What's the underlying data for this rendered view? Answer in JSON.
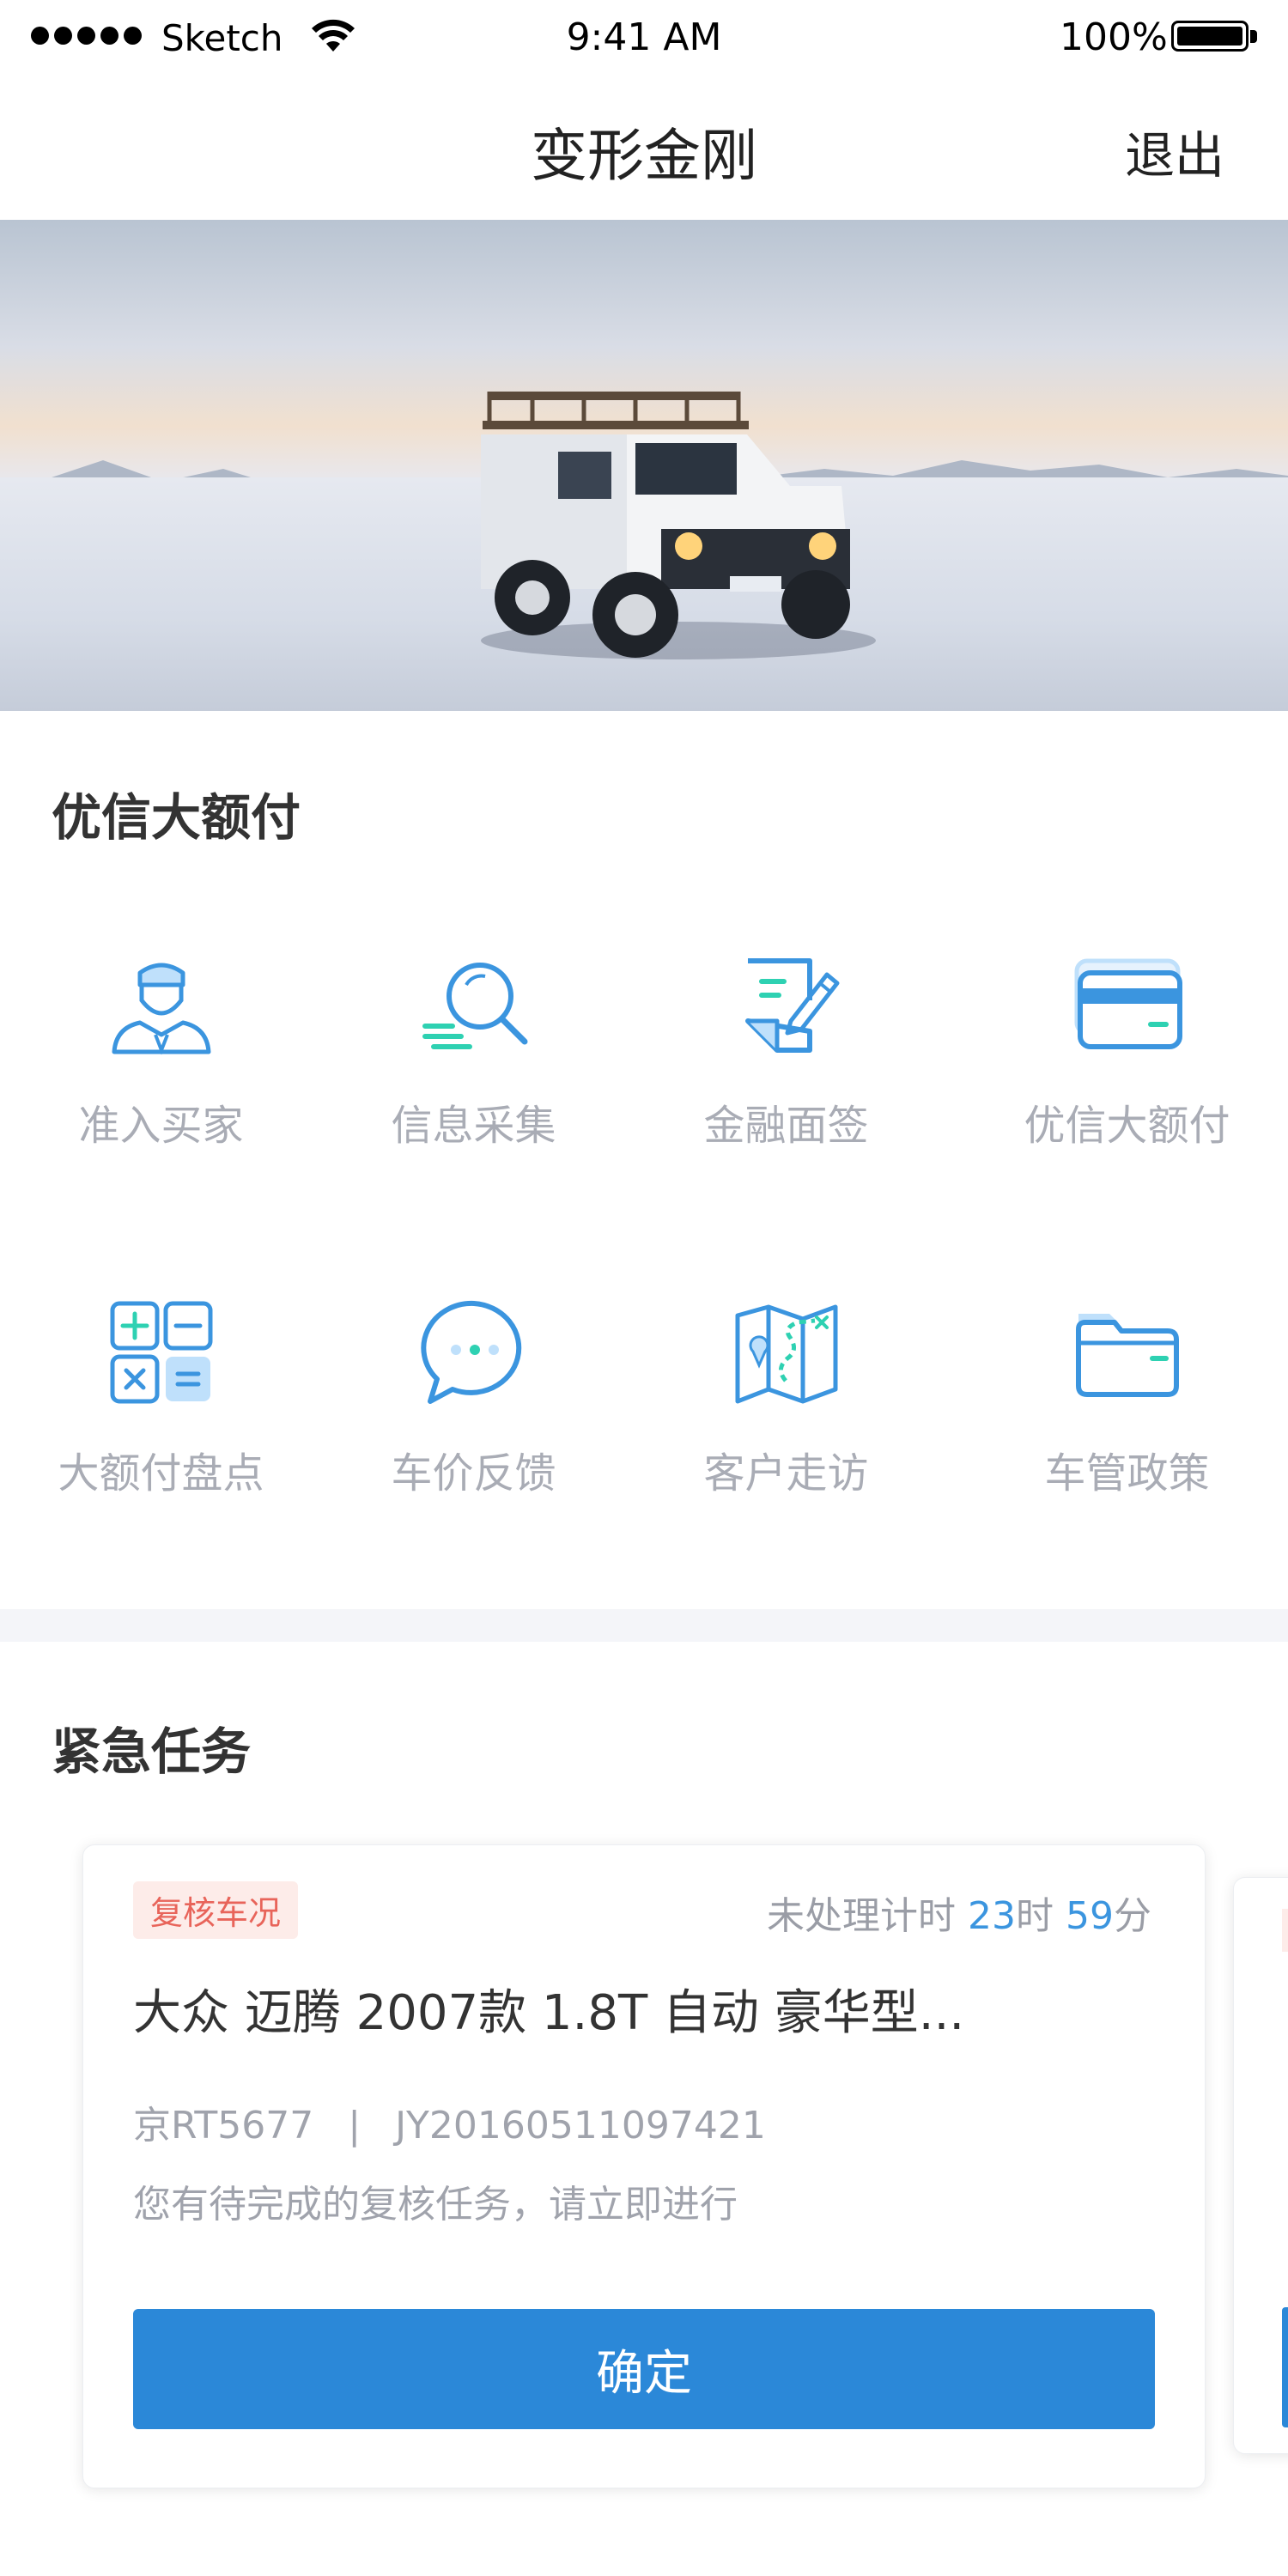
{
  "status_bar": {
    "carrier": "Sketch",
    "time": "9:41 AM",
    "battery": "100%"
  },
  "nav": {
    "title": "变形金刚",
    "logout": "退出"
  },
  "banner": {
    "image": "snowy landscape with white off-road vehicle at sunrise"
  },
  "services": {
    "title": "优信大额付",
    "items": [
      {
        "label": "准入买家",
        "icon": "buyer-avatar-icon"
      },
      {
        "label": "信息采集",
        "icon": "search-magnifier-icon"
      },
      {
        "label": "金融面签",
        "icon": "document-sign-icon"
      },
      {
        "label": "优信大额付",
        "icon": "credit-card-icon"
      },
      {
        "label": "大额付盘点",
        "icon": "calculator-icon"
      },
      {
        "label": "车价反馈",
        "icon": "chat-bubble-icon"
      },
      {
        "label": "客户走访",
        "icon": "map-route-icon"
      },
      {
        "label": "车管政策",
        "icon": "folder-icon"
      }
    ]
  },
  "tasks": {
    "title": "紧急任务",
    "card": {
      "tag": "复核车况",
      "timer_prefix": "未处理计时",
      "hours": "23",
      "hours_unit": "时",
      "minutes": "59",
      "minutes_unit": "分",
      "car_name": "大众  迈腾  2007款  1.8T 自动 豪华型...",
      "plate": "京RT5677",
      "separator": "|",
      "order_id": "JY20160511097421",
      "message": "您有待完成的复核任务，请立即进行",
      "button": "确定"
    }
  },
  "colors": {
    "accent": "#2b88d8",
    "icon_blue": "#3b95df",
    "icon_teal": "#2ed1b2",
    "tag_bg": "#fdece9",
    "tag_text": "#e8645a"
  }
}
